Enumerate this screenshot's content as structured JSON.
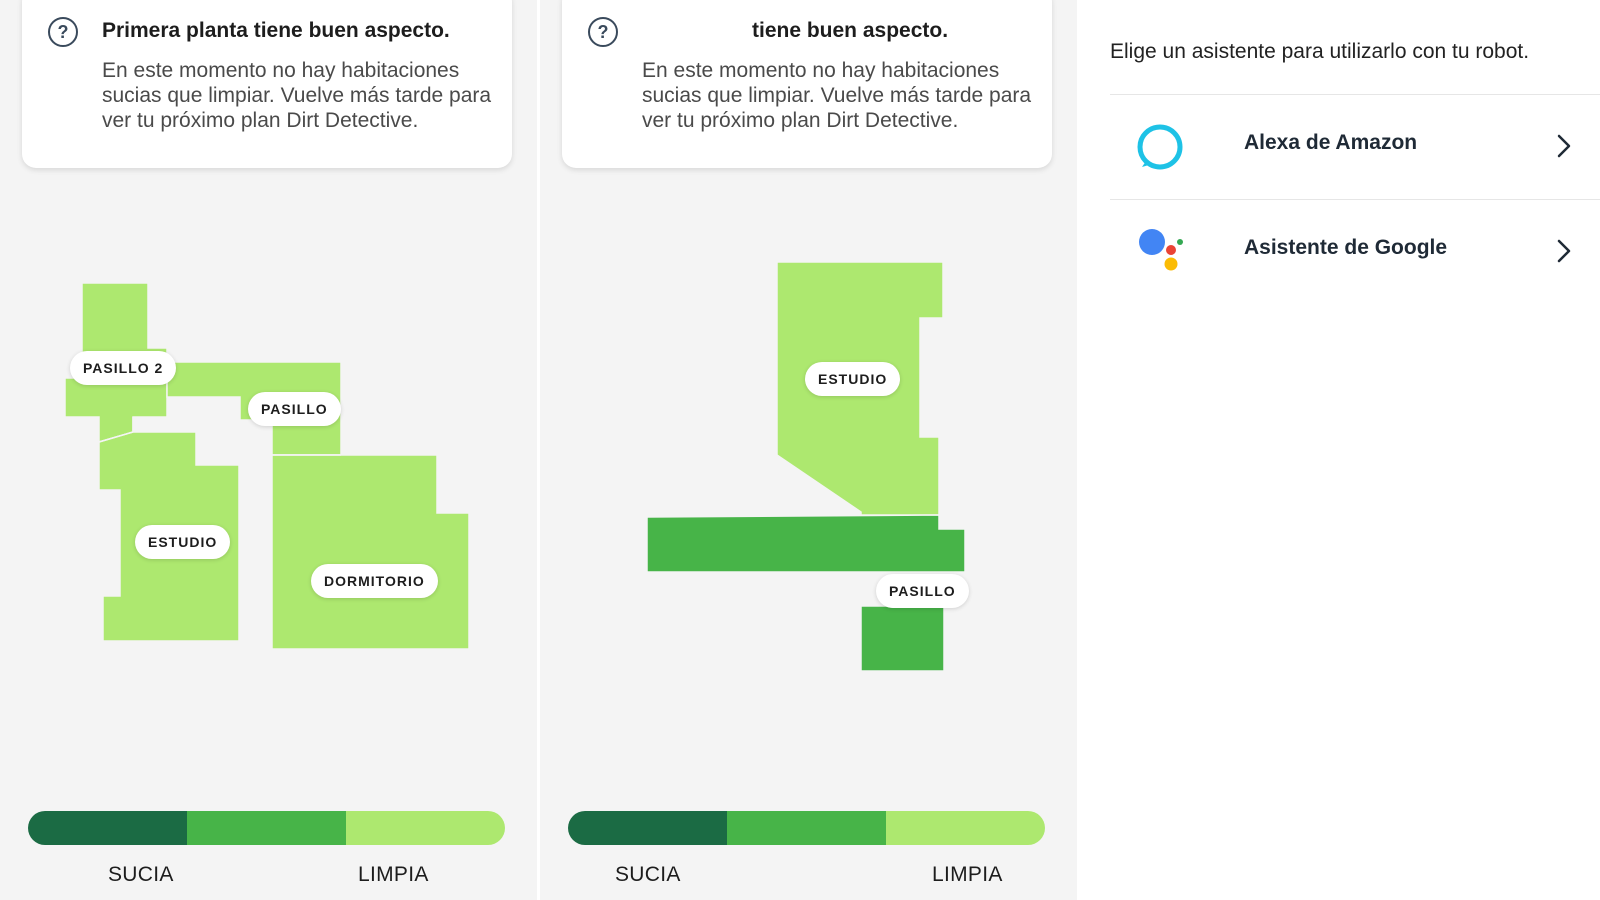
{
  "screens": [
    {
      "card": {
        "title": "Primera planta tiene buen aspecto.",
        "body": "En este momento no hay habitaciones sucias que limpiar. Vuelve más tarde para ver tu próximo plan Dirt Detective."
      },
      "rooms": {
        "pasillo2": "PASILLO 2",
        "pasillo": "PASILLO",
        "estudio": "ESTUDIO",
        "dormitorio": "DORMITORIO"
      },
      "legend": {
        "dirty_label": "SUCIA",
        "clean_label": "LIMPIA"
      }
    },
    {
      "card": {
        "title": "tiene buen aspecto.",
        "body": "En este momento no hay habitaciones sucias que limpiar. Vuelve más tarde para ver tu próximo plan Dirt Detective."
      },
      "rooms": {
        "estudio": "ESTUDIO",
        "pasillo": "PASILLO"
      },
      "legend": {
        "dirty_label": "SUCIA",
        "clean_label": "LIMPIA"
      }
    }
  ],
  "assistants": {
    "heading": "Elige un asistente para utilizarlo con tu robot.",
    "items": [
      {
        "label": "Alexa de Amazon",
        "icon": "alexa-icon"
      },
      {
        "label": "Asistente de Google",
        "icon": "google-assistant-icon"
      }
    ]
  },
  "colors": {
    "dirty": "#1b6b44",
    "medium": "#47b448",
    "clean": "#ade86f",
    "alexa": "#1ec2e6",
    "google_blue": "#4285f4",
    "google_red": "#ea4335",
    "google_yellow": "#fbbc05",
    "google_green": "#34a853"
  }
}
